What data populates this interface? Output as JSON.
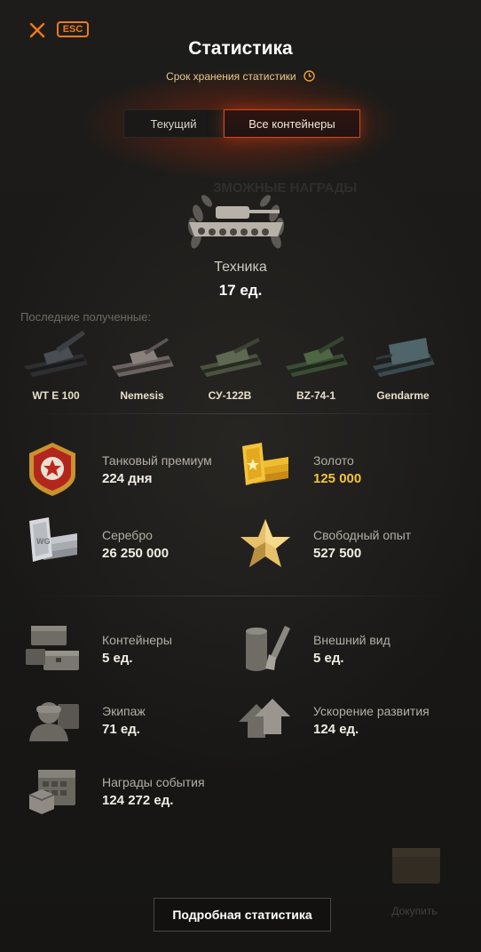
{
  "header": {
    "esc_label": "ESC",
    "title": "Статистика",
    "retention_label": "Срок хранения статистики"
  },
  "tabs": [
    {
      "label": "Текущий",
      "active": false
    },
    {
      "label": "Все контейнеры",
      "active": true
    }
  ],
  "vehicles": {
    "label": "Техника",
    "count": "17 ед.",
    "recent_label": "Последние полученные:",
    "recent": [
      {
        "name": "WT E 100"
      },
      {
        "name": "Nemesis"
      },
      {
        "name": "СУ-122В"
      },
      {
        "name": "BZ-74-1"
      },
      {
        "name": "Gendarme"
      }
    ]
  },
  "currencies": [
    {
      "label": "Танковый премиум",
      "value": "224 дня",
      "icon": "premium-badge-icon"
    },
    {
      "label": "Золото",
      "value": "125 000",
      "icon": "gold-icon",
      "accent": "#f4c33d"
    },
    {
      "label": "Серебро",
      "value": "26 250 000",
      "icon": "silver-icon"
    },
    {
      "label": "Свободный опыт",
      "value": "527 500",
      "icon": "free-xp-star-icon"
    }
  ],
  "items": [
    {
      "label": "Контейнеры",
      "value": "5 ед.",
      "icon": "containers-icon"
    },
    {
      "label": "Внешний вид",
      "value": "5 ед.",
      "icon": "customization-paint-icon"
    },
    {
      "label": "Экипаж",
      "value": "71 ед.",
      "icon": "crew-icon"
    },
    {
      "label": "Ускорение развития",
      "value": "124 ед.",
      "icon": "acceleration-arrows-icon"
    },
    {
      "label": "Награды события",
      "value": "124 272 ед.",
      "icon": "event-rewards-calendar-icon"
    }
  ],
  "footer": {
    "detail_button": "Подробная статистика",
    "buy_label": "Докупить"
  },
  "colors": {
    "accent_orange": "#f07a1a",
    "active_tab_border": "#d24a1f",
    "gold_text": "#f4c33d"
  }
}
